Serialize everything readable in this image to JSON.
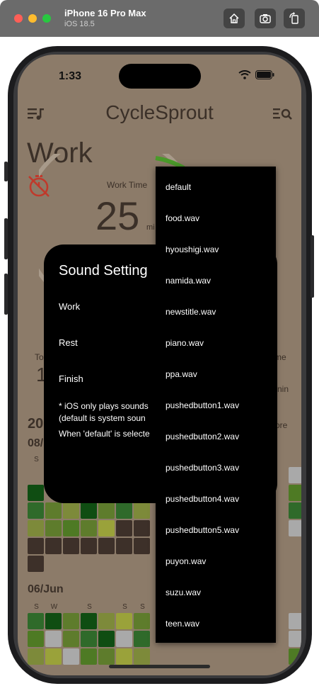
{
  "simulator": {
    "device": "iPhone 16 Pro Max",
    "os": "iOS 18.5",
    "buttons": [
      "home-icon",
      "screenshot-icon",
      "rotate-icon"
    ]
  },
  "status_bar": {
    "time": "1:33"
  },
  "app": {
    "title": "CycleSprout"
  },
  "timer": {
    "mode": "Work",
    "label": "Work Time",
    "value": "25",
    "unit_prefix": "mi",
    "progress": 0.08
  },
  "background_fragments": {
    "to": "To",
    "one": "1",
    "me": "me",
    "min": "nin",
    "ore": "ore",
    "date1_prefix": "20",
    "date2": "08/",
    "date3": "06/Jun",
    "dow1": [
      "S",
      "",
      "",
      "",
      "",
      "",
      "S"
    ],
    "dow2": [
      "S",
      "W",
      "",
      "S",
      "",
      "S",
      "S"
    ]
  },
  "dialog": {
    "title": "Sound Setting",
    "rows": [
      "Work",
      "Rest",
      "Finish"
    ],
    "note_line1": "* iOS only plays sounds",
    "note_line2": "(default is system soun",
    "note_line3": "When 'default' is selecte"
  },
  "menu": {
    "items": [
      "default",
      "food.wav",
      "hyoushigi.wav",
      "namida.wav",
      "newstitle.wav",
      "piano.wav",
      "ppa.wav",
      "pushedbutton1.wav",
      "pushedbutton2.wav",
      "pushedbutton3.wav",
      "pushedbutton4.wav",
      "pushedbutton5.wav",
      "puyon.wav",
      "suzu.wav",
      "teen.wav"
    ]
  },
  "colors": {
    "screen_bg": "#8c7b69",
    "menu_bg": "#000000",
    "dialog_bg": "#000000",
    "accent_red": "#c0392b",
    "progress_green": "#4a9a2a"
  }
}
